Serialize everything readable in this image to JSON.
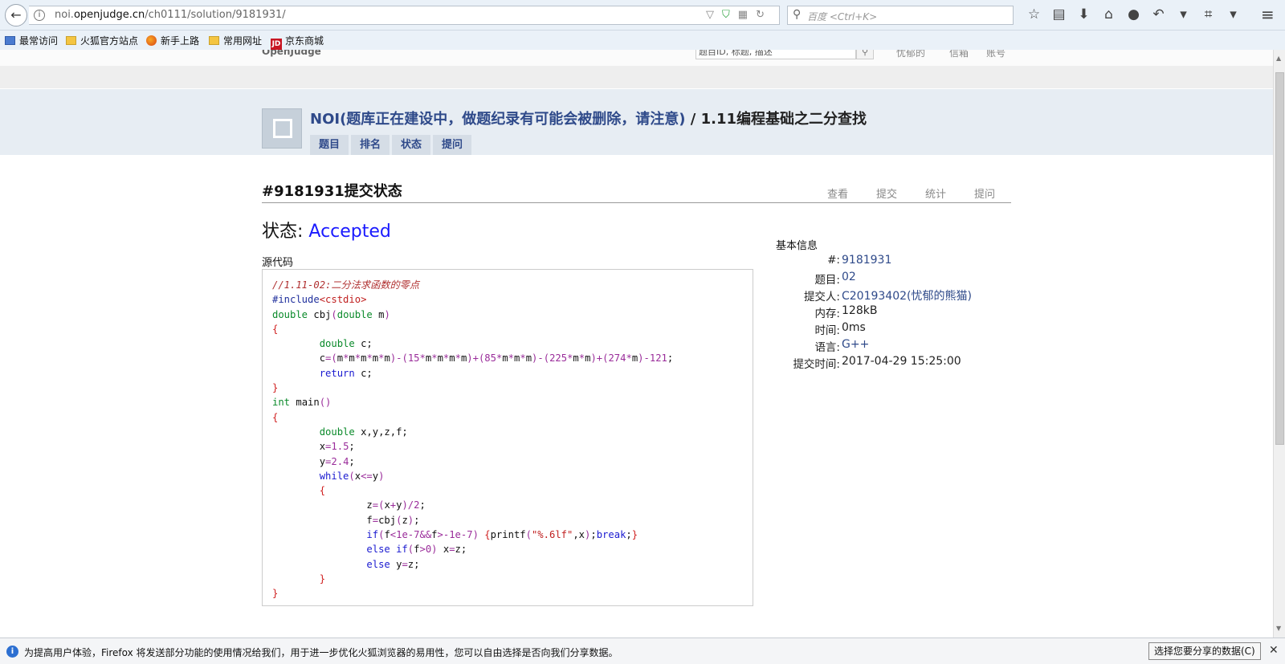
{
  "browser": {
    "url_prefix": "noi.",
    "url_domain": "openjudge.cn",
    "url_path": "/ch0111/solution/9181931/",
    "search_placeholder": "百度 <Ctrl+K>"
  },
  "bookmarks": [
    {
      "label": "最常访问"
    },
    {
      "label": "火狐官方站点"
    },
    {
      "label": "新手上路"
    },
    {
      "label": "常用网址"
    },
    {
      "label": "京东商城"
    }
  ],
  "site": {
    "logo": "OpenJudge",
    "search_placeholder": "题目ID, 标题, 描述",
    "links": [
      "忧郁的",
      "信箱",
      "账号"
    ]
  },
  "group": {
    "name": "NOI(题库正在建设中，做题纪录有可能会被删除，请注意)",
    "separator": " / ",
    "section": "1.11编程基础之二分查找",
    "tabs": [
      "题目",
      "排名",
      "状态",
      "提问"
    ]
  },
  "submission": {
    "title": "#9181931提交状态",
    "links": [
      "查看",
      "提交",
      "统计",
      "提问"
    ],
    "status_label": "状态: ",
    "status_value": "Accepted",
    "source_label": "源代码"
  },
  "info": {
    "title": "基本信息",
    "rows": [
      {
        "label": "#:",
        "value": "9181931"
      },
      {
        "label": "题目:",
        "value": "02"
      },
      {
        "label": "提交人:",
        "value": "C20193402(忧郁的熊猫)"
      },
      {
        "label": "内存:",
        "value": "128kB"
      },
      {
        "label": "时间:",
        "value": "0ms"
      },
      {
        "label": "语言:",
        "value": "G++"
      },
      {
        "label": "提交时间:",
        "value": "2017-04-29 15:25:00"
      }
    ]
  },
  "code": {
    "comment": "//1.11-02:二分法求函数的零点",
    "include": "#include",
    "include_arg": "<cstdio>"
  },
  "notification": {
    "text": "为提高用户体验，Firefox 将发送部分功能的使用情况给我们，用于进一步优化火狐浏览器的易用性，您可以自由选择是否向我们分享数据。",
    "button": "选择您要分享的数据(C)"
  }
}
